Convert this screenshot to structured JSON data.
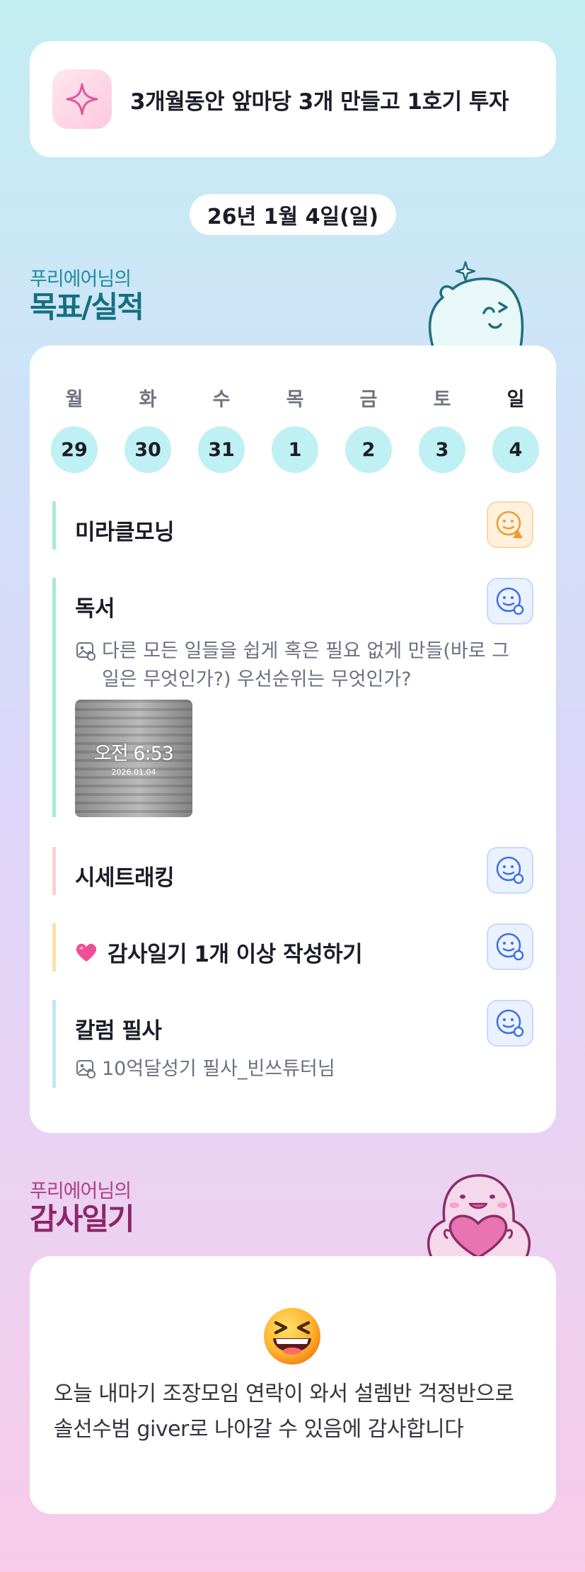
{
  "goal": {
    "text": "3개월동안 앞마당 3개 만들고 1호기 투자",
    "icon": "sparkle-icon"
  },
  "date_label": "26년 1월 4일(일)",
  "goals_section": {
    "owner": "푸리에어님의",
    "title": "목표/실적"
  },
  "week": [
    {
      "label": "월",
      "num": "29"
    },
    {
      "label": "화",
      "num": "30"
    },
    {
      "label": "수",
      "num": "31"
    },
    {
      "label": "목",
      "num": "1"
    },
    {
      "label": "금",
      "num": "2"
    },
    {
      "label": "토",
      "num": "3"
    },
    {
      "label": "일",
      "num": "4",
      "today": true
    }
  ],
  "tasks": [
    {
      "title": "미라클모닝",
      "bar_color": "#a8ead8",
      "status": "warning",
      "status_icon": "smile-warning-icon"
    },
    {
      "title": "독서",
      "bar_color": "#a8ead8",
      "status": "done",
      "status_icon": "smile-check-icon",
      "note": "다른 모든 일들을 쉽게 혹은 필요 없게 만들(바로 그 일은 무엇인가?) 우선순위는 무엇인가?",
      "photo": {
        "time": "오전 6:53",
        "date": "2026.01.04"
      }
    },
    {
      "title": "시세트래킹",
      "bar_color": "#f9d3d3",
      "status": "done",
      "status_icon": "smile-check-icon"
    },
    {
      "title": "감사일기 1개 이상 작성하기",
      "bar_color": "#fde0a8",
      "status": "done",
      "status_icon": "smile-check-icon",
      "emoji": "heart-icon"
    },
    {
      "title": "칼럼 필사",
      "bar_color": "#c2e6f5",
      "status": "done",
      "status_icon": "smile-check-icon",
      "note": "10억달성기 필사_빈쓰튜터님"
    }
  ],
  "diary_section": {
    "owner": "푸리에어님의",
    "title": "감사일기",
    "emoji": "laughing-face-icon",
    "text": "오늘 내마기 조장모임 연락이 와서 설렘반 걱정반으로 솔선수범 giver로 나아갈 수 있음에 감사합니다"
  }
}
